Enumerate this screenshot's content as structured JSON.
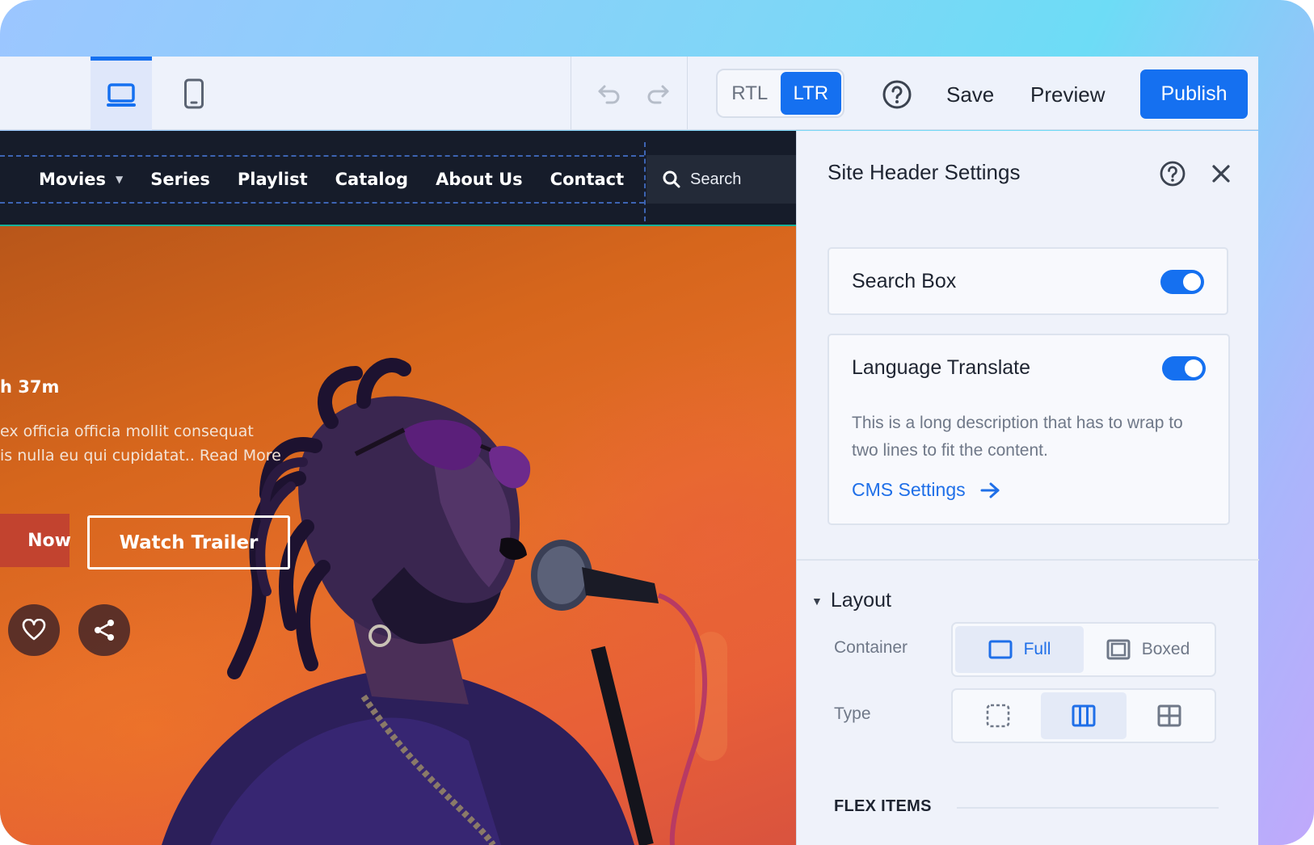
{
  "toolbar": {
    "device_desktop_icon": "desktop-icon",
    "device_mobile_icon": "mobile-icon",
    "undo_icon": "undo-icon",
    "redo_icon": "redo-icon",
    "direction_options": [
      "RTL",
      "LTR"
    ],
    "direction_selected": "LTR",
    "help_icon": "help-circle-icon",
    "save_label": "Save",
    "preview_label": "Preview",
    "publish_label": "Publish",
    "accent": "#1570f0"
  },
  "site": {
    "nav": {
      "items": [
        "Movies",
        "Series",
        "Playlist",
        "Catalog",
        "About Us",
        "Contact"
      ],
      "search_placeholder": "Search"
    },
    "hero": {
      "duration": "h 37m",
      "desc_line1": "ex officia officia mollit consequat",
      "desc_line2": "is nulla eu qui cupidatat.. Read More",
      "primary_button": "Now",
      "secondary_button": "Watch Trailer",
      "like_icon": "heart-icon",
      "share_icon": "share-icon"
    }
  },
  "panel": {
    "title": "Site Header Settings",
    "search_box": {
      "label": "Search Box",
      "enabled": true
    },
    "language_translate": {
      "label": "Language Translate",
      "enabled": true,
      "description": "This is a long description that has to wrap to two lines to fit the content.",
      "link_label": "CMS Settings"
    },
    "layout": {
      "heading": "Layout",
      "container_label": "Container",
      "container_options": [
        "Full",
        "Boxed"
      ],
      "container_selected": "Full",
      "type_label": "Type",
      "type_options": [
        "none-icon",
        "columns-icon",
        "grid-icon"
      ],
      "type_selected": "columns-icon",
      "flex_items_heading": "FLEX ITEMS"
    }
  }
}
